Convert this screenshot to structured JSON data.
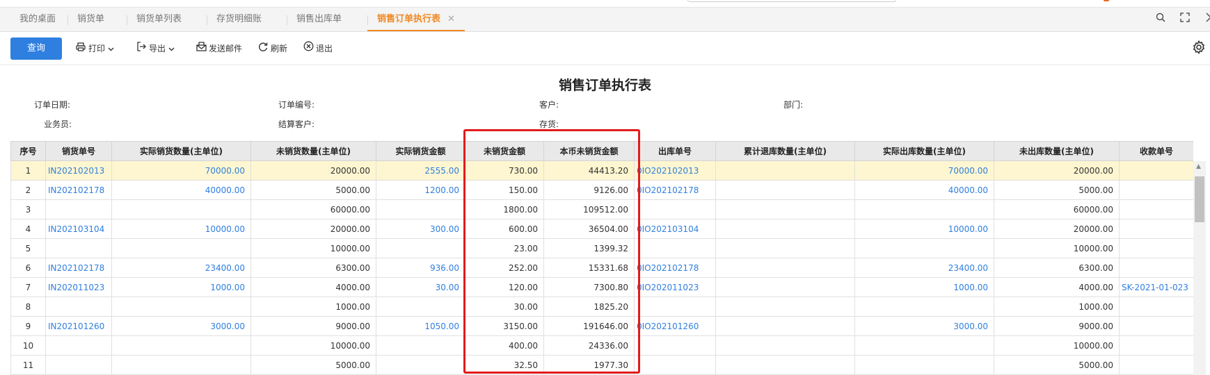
{
  "tabs": [
    {
      "label": "我的桌面"
    },
    {
      "label": "销货单"
    },
    {
      "label": "销货单列表"
    },
    {
      "label": "存货明细账"
    },
    {
      "label": "销售出库单"
    },
    {
      "label": "销售订单执行表",
      "active": true
    }
  ],
  "tab_close": "✕",
  "toolbar": {
    "query": "查询",
    "print": "打印",
    "export": "导出",
    "send_mail": "发送邮件",
    "refresh": "刷新",
    "exit": "退出"
  },
  "report": {
    "title": "销售订单执行表",
    "filters": {
      "order_date": "订单日期:",
      "order_no": "订单编号:",
      "customer": "客户:",
      "department": "部门:",
      "salesperson": "业务员:",
      "settle_customer": "结算客户:",
      "inventory": "存货:"
    }
  },
  "table": {
    "columns": [
      "序号",
      "销货单号",
      "实际销货数量(主单位)",
      "未销货数量(主单位)",
      "实际销货金额",
      "未销货金额",
      "本币未销货金额",
      "出库单号",
      "累计退库数量(主单位)",
      "实际出库数量(主单位)",
      "未出库数量(主单位)",
      "收款单号"
    ],
    "rows": [
      [
        "1",
        "IN202102013",
        "70000.00",
        "20000.00",
        "2555.00",
        "730.00",
        "44413.20",
        "0IO202102013",
        "",
        "70000.00",
        "20000.00",
        ""
      ],
      [
        "2",
        "IN202102178",
        "40000.00",
        "5000.00",
        "1200.00",
        "150.00",
        "9126.00",
        "0IO202102178",
        "",
        "40000.00",
        "5000.00",
        ""
      ],
      [
        "3",
        "",
        "",
        "60000.00",
        "",
        "1800.00",
        "109512.00",
        "",
        "",
        "",
        "60000.00",
        ""
      ],
      [
        "4",
        "IN202103104",
        "10000.00",
        "20000.00",
        "300.00",
        "600.00",
        "36504.00",
        "0IO202103104",
        "",
        "10000.00",
        "20000.00",
        ""
      ],
      [
        "5",
        "",
        "",
        "10000.00",
        "",
        "23.00",
        "1399.32",
        "",
        "",
        "",
        "10000.00",
        ""
      ],
      [
        "6",
        "IN202102178",
        "23400.00",
        "6300.00",
        "936.00",
        "252.00",
        "15331.68",
        "0IO202102178",
        "",
        "23400.00",
        "6300.00",
        ""
      ],
      [
        "7",
        "IN202011023",
        "1000.00",
        "4000.00",
        "30.00",
        "120.00",
        "7300.80",
        "0IO202011023",
        "",
        "1000.00",
        "4000.00",
        "SK-2021-01-023"
      ],
      [
        "8",
        "",
        "",
        "1000.00",
        "",
        "30.00",
        "1825.20",
        "",
        "",
        "",
        "1000.00",
        ""
      ],
      [
        "9",
        "IN202101260",
        "3000.00",
        "9000.00",
        "1050.00",
        "3150.00",
        "191646.00",
        "0IO202101260",
        "",
        "3000.00",
        "9000.00",
        ""
      ],
      [
        "10",
        "",
        "",
        "10000.00",
        "",
        "400.00",
        "24336.00",
        "",
        "",
        "",
        "10000.00",
        ""
      ],
      [
        "11",
        "",
        "",
        "5000.00",
        "",
        "32.50",
        "1977.30",
        "",
        "",
        "",
        "5000.00",
        ""
      ]
    ]
  },
  "colors": {
    "accent": "#2f7fe0",
    "active_tab": "#f08a24",
    "highlight": "#e21b1b",
    "selected_row": "#fdf6d0"
  }
}
